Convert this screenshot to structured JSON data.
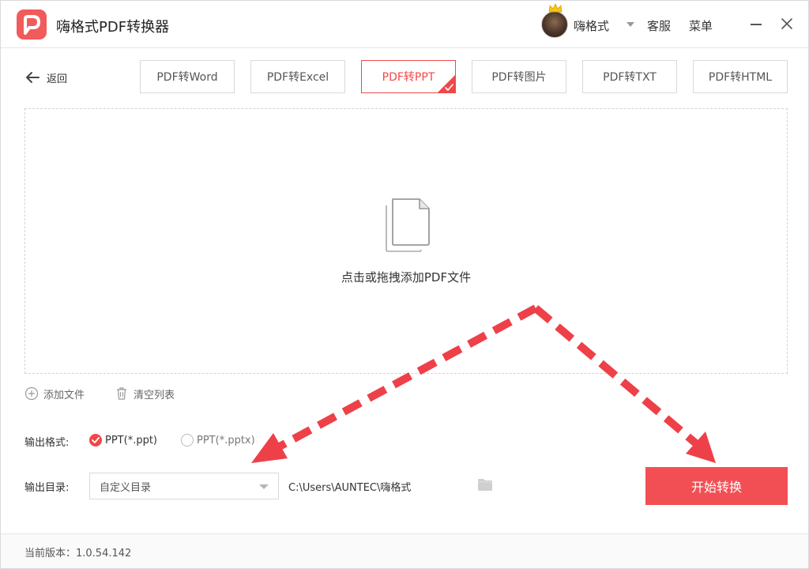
{
  "app": {
    "title": "嗨格式PDF转换器"
  },
  "user": {
    "name": "嗨格式"
  },
  "header": {
    "service_label": "客服",
    "menu_label": "菜单"
  },
  "nav": {
    "back_label": "返回"
  },
  "tabs": [
    {
      "label": "PDF转Word",
      "active": false
    },
    {
      "label": "PDF转Excel",
      "active": false
    },
    {
      "label": "PDF转PPT",
      "active": true
    },
    {
      "label": "PDF转图片",
      "active": false
    },
    {
      "label": "PDF转TXT",
      "active": false
    },
    {
      "label": "PDF转HTML",
      "active": false
    }
  ],
  "dropzone": {
    "text": "点击或拖拽添加PDF文件"
  },
  "file_actions": {
    "add_label": "添加文件",
    "clear_label": "清空列表"
  },
  "output_format": {
    "label": "输出格式:",
    "options": [
      {
        "label": "PPT(*.ppt)",
        "checked": true
      },
      {
        "label": "PPT(*.pptx)",
        "checked": false
      }
    ]
  },
  "output_dir": {
    "label": "输出目录:",
    "select_value": "自定义目录",
    "path": "C:\\Users\\AUNTEC\\嗨格式"
  },
  "start_button": {
    "label": "开始转换"
  },
  "footer": {
    "version": "当前版本：1.0.54.142"
  },
  "colors": {
    "accent": "#f04848",
    "button": "#f24f54",
    "annotation_arrow": "#ee4048"
  }
}
